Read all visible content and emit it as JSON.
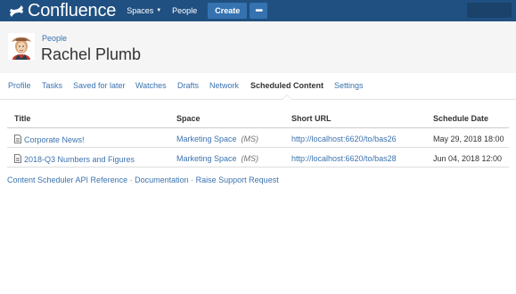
{
  "topbar": {
    "logo_text": "Confluence",
    "nav_spaces": "Spaces",
    "nav_people": "People",
    "create_label": "Create",
    "more_label": "•••",
    "bar_color": "#205081",
    "button_color": "#3572b0"
  },
  "header": {
    "breadcrumb": "People",
    "title": "Rachel Plumb"
  },
  "tabs": [
    {
      "label": "Profile"
    },
    {
      "label": "Tasks"
    },
    {
      "label": "Saved for later"
    },
    {
      "label": "Watches"
    },
    {
      "label": "Drafts"
    },
    {
      "label": "Network"
    },
    {
      "label": "Scheduled Content",
      "active": true
    },
    {
      "label": "Settings"
    }
  ],
  "table": {
    "columns": [
      "Title",
      "Space",
      "Short URL",
      "Schedule Date"
    ],
    "rows": [
      {
        "title": "Corporate News!",
        "space": "Marketing Space",
        "space_key": "(MS)",
        "short_url": "http://localhost:6620/to/bas26",
        "date": "May 29, 2018 18:00"
      },
      {
        "title": "2018-Q3 Numbers and Figures",
        "space": "Marketing Space",
        "space_key": "(MS)",
        "short_url": "http://localhost:6620/to/bas28",
        "date": "Jun 04, 2018 12:00"
      }
    ]
  },
  "footer": {
    "api_reference": "Content Scheduler API Reference",
    "documentation": "Documentation",
    "support": "Raise Support Request",
    "separator": " · "
  },
  "colors": {
    "link": "#3b73af",
    "header_bg": "#f5f5f5"
  },
  "icons": {
    "logo": "confluence-x-icon",
    "avatar": "user-avatar",
    "page": "page-icon"
  }
}
